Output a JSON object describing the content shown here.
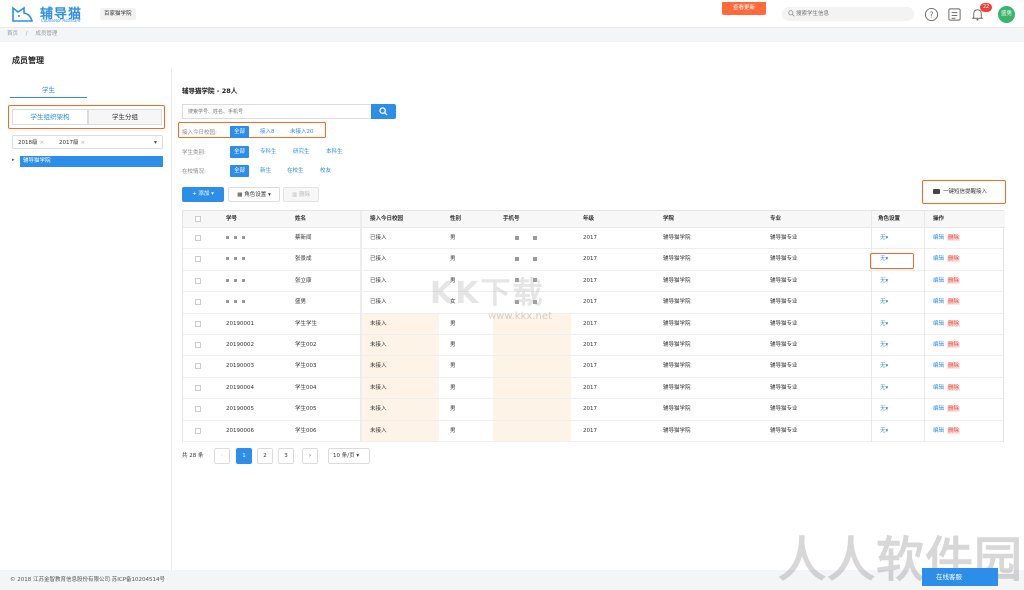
{
  "header": {
    "logo_text": "辅导猫",
    "logo_sub": "Counselor Assistant",
    "school_tag": "百家猫学院",
    "update_btn": "查看更新",
    "search_placeholder": "搜索学生信息",
    "notification_count": "22",
    "avatar_text": "盛男"
  },
  "breadcrumb": [
    "首页",
    "成员管理"
  ],
  "page_title": "成员管理",
  "left": {
    "tab": "学生",
    "seg_a": "学生组织架构",
    "seg_b": "学生分组",
    "grades": [
      "2018级",
      "2017级"
    ],
    "tree_node": "辅导猫学院"
  },
  "main": {
    "title": "辅导猫学院 - 28人",
    "search_placeholder": "搜索学号、姓名、手机号",
    "filters": [
      {
        "label": "接入今日校园:",
        "options": [
          "全部",
          "接入8",
          "未接入20"
        ]
      },
      {
        "label": "学生类别:",
        "options": [
          "全部",
          "专科生",
          "研究生",
          "本科生"
        ]
      },
      {
        "label": "在校情况:",
        "options": [
          "全部",
          "新生",
          "在校生",
          "校友"
        ]
      }
    ],
    "btn_add": "+ 添加 ▾",
    "btn_role": "▦ 角色设置 ▾",
    "btn_delete": "▥ 删除",
    "btn_sms": "一键短信提醒接入"
  },
  "table": {
    "headers": [
      "学号",
      "姓名",
      "接入今日校园",
      "性别",
      "手机号",
      "年级",
      "学院",
      "专业",
      "角色设置",
      "操作"
    ],
    "rows": [
      {
        "id": "",
        "name": "蔡新闻",
        "status": "已接入",
        "gender": "男",
        "phone": "",
        "grade": "2017",
        "college": "辅导猫学院",
        "major": "辅导猫专业",
        "role": "无",
        "edit": "编辑",
        "del": "删除"
      },
      {
        "id": "",
        "name": "张景成",
        "status": "已接入",
        "gender": "男",
        "phone": "",
        "grade": "2017",
        "college": "辅导猫学院",
        "major": "辅导猫专业",
        "role": "无",
        "edit": "编辑",
        "del": "删除"
      },
      {
        "id": "",
        "name": "张立康",
        "status": "已接入",
        "gender": "男",
        "phone": "",
        "grade": "2017",
        "college": "辅导猫学院",
        "major": "辅导猫专业",
        "role": "无",
        "edit": "编辑",
        "del": "删除"
      },
      {
        "id": "",
        "name": "盛男",
        "status": "已接入",
        "gender": "女",
        "phone": "",
        "grade": "2017",
        "college": "辅导猫学院",
        "major": "辅导猫专业",
        "role": "无",
        "edit": "编辑",
        "del": "删除"
      },
      {
        "id": "20190001",
        "name": "学生学生",
        "status": "未接入",
        "gender": "男",
        "phone": "",
        "grade": "2017",
        "college": "辅导猫学院",
        "major": "辅导猫专业",
        "role": "无",
        "edit": "编辑",
        "del": "删除"
      },
      {
        "id": "20190002",
        "name": "学生002",
        "status": "未接入",
        "gender": "男",
        "phone": "",
        "grade": "2017",
        "college": "辅导猫学院",
        "major": "辅导猫专业",
        "role": "无",
        "edit": "编辑",
        "del": "删除"
      },
      {
        "id": "20190003",
        "name": "学生003",
        "status": "未接入",
        "gender": "男",
        "phone": "",
        "grade": "2017",
        "college": "辅导猫学院",
        "major": "辅导猫专业",
        "role": "无",
        "edit": "编辑",
        "del": "删除"
      },
      {
        "id": "20190004",
        "name": "学生004",
        "status": "未接入",
        "gender": "男",
        "phone": "",
        "grade": "2017",
        "college": "辅导猫学院",
        "major": "辅导猫专业",
        "role": "无",
        "edit": "编辑",
        "del": "删除"
      },
      {
        "id": "20190005",
        "name": "学生005",
        "status": "未接入",
        "gender": "男",
        "phone": "",
        "grade": "2017",
        "college": "辅导猫学院",
        "major": "辅导猫专业",
        "role": "无",
        "edit": "编辑",
        "del": "删除"
      },
      {
        "id": "20190006",
        "name": "学生006",
        "status": "未接入",
        "gender": "男",
        "phone": "",
        "grade": "2017",
        "college": "辅导猫学院",
        "major": "辅导猫专业",
        "role": "无",
        "edit": "编辑",
        "del": "删除"
      }
    ]
  },
  "pager": {
    "total": "共 28 条",
    "pages": [
      "1",
      "2",
      "3"
    ],
    "prev": "‹",
    "next": "›",
    "page_size": "10 条/页"
  },
  "footer": "© 2018 江苏金智教育信息股份有限公司 苏ICP备10204514号",
  "chat_btn": "在线客服",
  "watermarks": {
    "a": "KK下载",
    "b": "www.kkx.net",
    "c": "人人软件园"
  },
  "colors": {
    "accent": "#2c8ee8",
    "highlight": "#f26a21",
    "danger": "#f04134"
  }
}
